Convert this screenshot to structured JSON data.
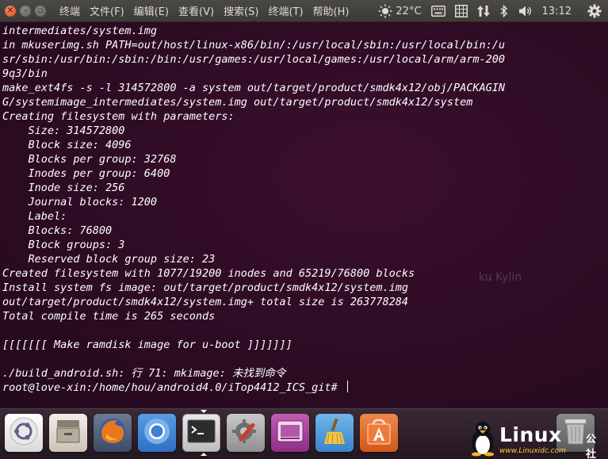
{
  "topbar": {
    "menus": [
      "终端",
      "文件(F)",
      "编辑(E)",
      "查看(V)",
      "搜索(S)",
      "终端(T)",
      "帮助(H)"
    ],
    "weather": "22°C",
    "time": "13:12"
  },
  "terminal": {
    "lines": [
      "intermediates/system.img",
      "in mkuserimg.sh PATH=out/host/linux-x86/bin/:/usr/local/sbin:/usr/local/bin:/u",
      "sr/sbin:/usr/bin:/sbin:/bin:/usr/games:/usr/local/games:/usr/local/arm/arm-200",
      "9q3/bin",
      "make_ext4fs -s -l 314572800 -a system out/target/product/smdk4x12/obj/PACKAGIN",
      "G/systemimage_intermediates/system.img out/target/product/smdk4x12/system",
      "Creating filesystem with parameters:",
      "    Size: 314572800",
      "    Block size: 4096",
      "    Blocks per group: 32768",
      "    Inodes per group: 6400",
      "    Inode size: 256",
      "    Journal blocks: 1200",
      "    Label:",
      "    Blocks: 76800",
      "    Block groups: 3",
      "    Reserved block group size: 23",
      "Created filesystem with 1077/19200 inodes and 65219/76800 blocks",
      "Install system fs image: out/target/product/smdk4x12/system.img",
      "out/target/product/smdk4x12/system.img+ total size is 263778284",
      "Total compile time is 265 seconds",
      "",
      "[[[[[[[ Make ramdisk image for u-boot ]]]]]]]",
      "",
      "./build_android.sh: 行 71: mkimage: 未找到命令"
    ],
    "prompt": "root@love-xin:/home/hou/android4.0/iTop4412_ICS_git# ",
    "watermark": "ku Kylin"
  },
  "dock": {
    "icons": [
      "ubuntu-icon",
      "files-icon",
      "firefox-icon",
      "chromium-icon",
      "terminal-icon",
      "settings-icon",
      "video-icon",
      "cleaner-icon",
      "software-center-icon",
      "trash-icon"
    ]
  },
  "logo": {
    "word": "Linux",
    "cn": "公社",
    "url": "www.Linuxidc.com"
  },
  "colors": {
    "terminal_bg": "#2c0b23",
    "panel_bg": "#3c3b37",
    "close_button": "#df4a16",
    "text": "#ffffff"
  }
}
